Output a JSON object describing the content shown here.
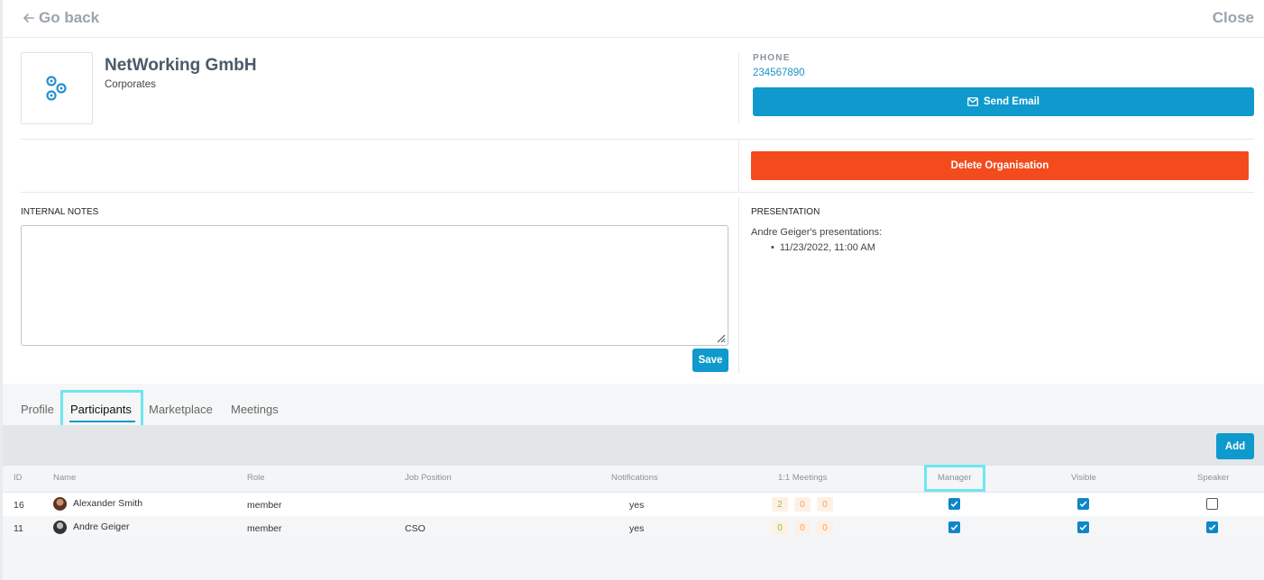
{
  "nav": {
    "back_label": "Go back",
    "close_label": "Close"
  },
  "org": {
    "name": "NetWorking GmbH",
    "type": "Corporates",
    "logo_icon": "network-logo"
  },
  "contact": {
    "phone_label": "PHONE",
    "phone_value": "234567890",
    "send_email_label": "Send Email",
    "delete_label": "Delete Organisation"
  },
  "notes": {
    "label": "INTERNAL NOTES",
    "value": "",
    "save_label": "Save"
  },
  "presentation": {
    "label": "PRESENTATION",
    "text": "Andre Geiger's presentations:",
    "items": [
      "11/23/2022, 11:00 AM"
    ]
  },
  "tabs": [
    {
      "label": "Profile",
      "active": false
    },
    {
      "label": "Participants",
      "active": true
    },
    {
      "label": "Marketplace",
      "active": false
    },
    {
      "label": "Meetings",
      "active": false
    }
  ],
  "toolbar": {
    "add_label": "Add"
  },
  "table": {
    "headers": [
      "ID",
      "Name",
      "Role",
      "Job Position",
      "Notifications",
      "1:1 Meetings",
      "Manager",
      "Visible",
      "Speaker"
    ],
    "rows": [
      {
        "id": "16",
        "name": "Alexander Smith",
        "role": "member",
        "job": "",
        "notifications": "yes",
        "meetings": [
          "2",
          "0",
          "0"
        ],
        "manager": true,
        "visible": true,
        "speaker": false
      },
      {
        "id": "11",
        "name": "Andre Geiger",
        "role": "member",
        "job": "CSO",
        "notifications": "yes",
        "meetings": [
          "0",
          "0",
          "0"
        ],
        "manager": true,
        "visible": true,
        "speaker": true
      }
    ]
  },
  "colors": {
    "primary": "#0f99cc",
    "danger": "#f34b1d",
    "highlight": "#6ee6f2",
    "meeting_green": "#8cc63f",
    "meeting_orange": "#f0a35a"
  }
}
